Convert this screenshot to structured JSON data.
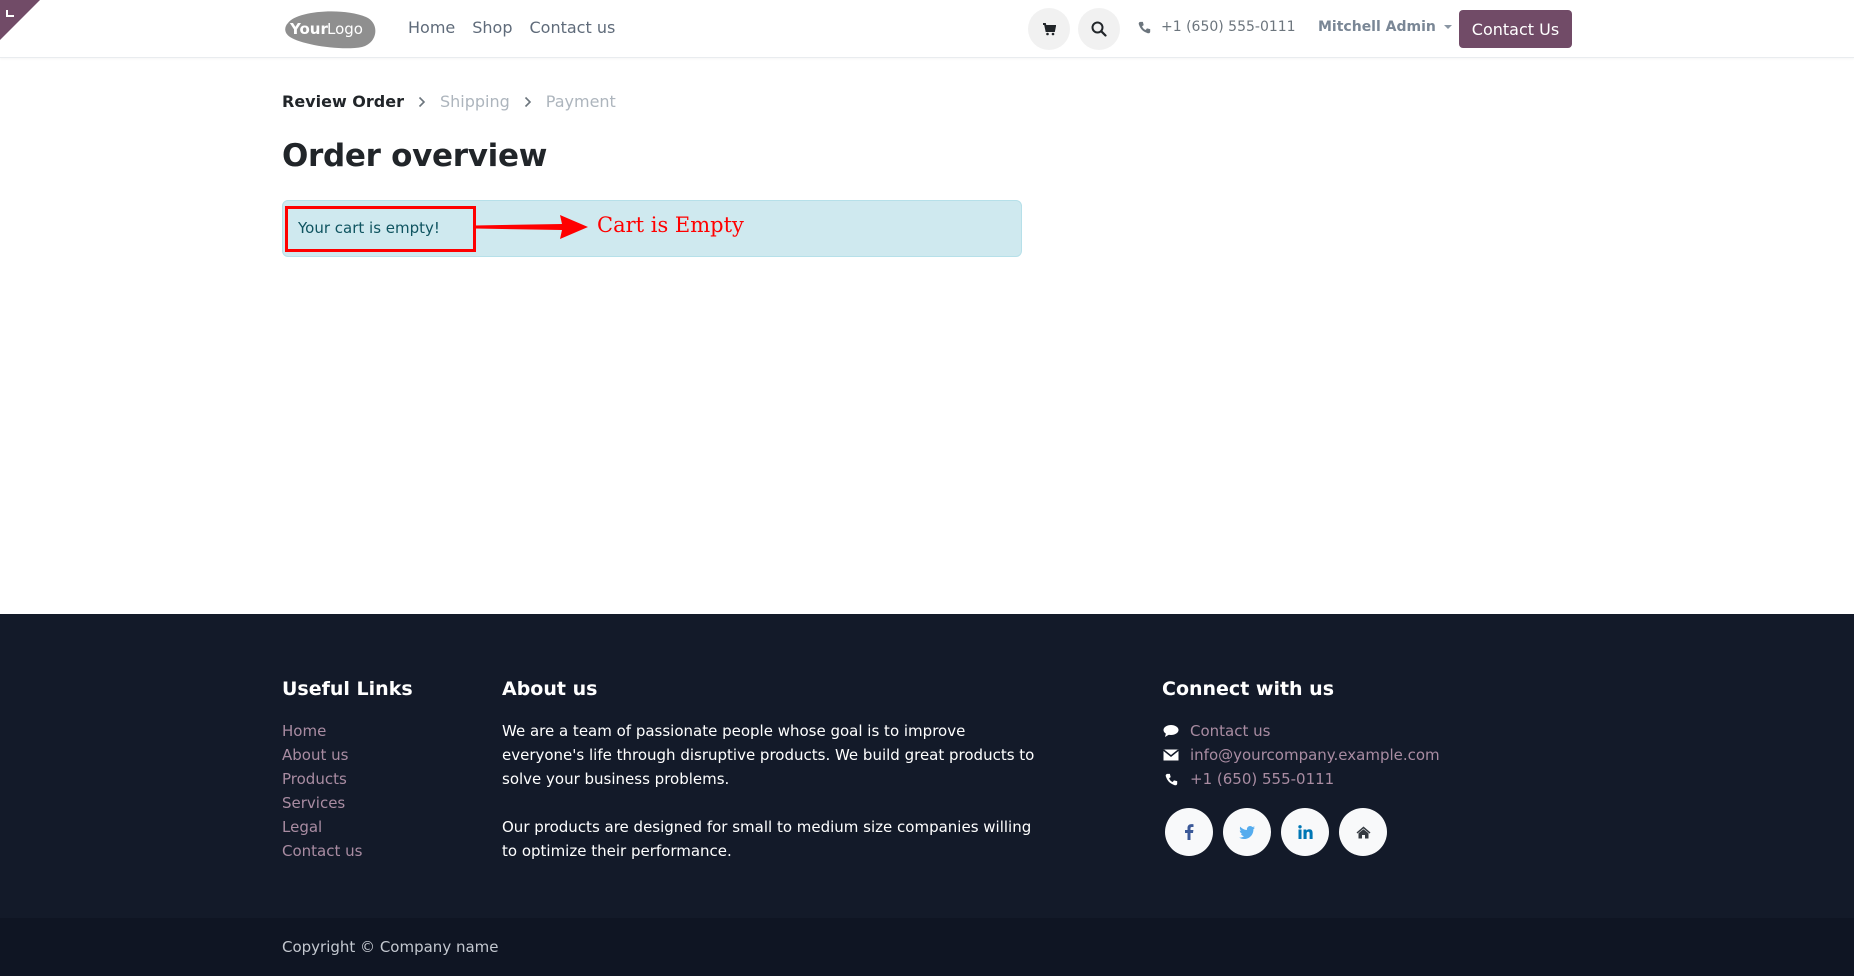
{
  "header": {
    "logo_text_bold": "Your",
    "logo_text_light": "Logo",
    "nav": [
      {
        "label": "Home"
      },
      {
        "label": "Shop"
      },
      {
        "label": "Contact us"
      }
    ],
    "phone": "+1 (650) 555-0111",
    "user_name": "Mitchell Admin",
    "contact_button": "Contact Us",
    "brand_color": "#714b67"
  },
  "checkout": {
    "steps": [
      {
        "label": "Review Order",
        "state": "active"
      },
      {
        "label": "Shipping",
        "state": "inactive"
      },
      {
        "label": "Payment",
        "state": "inactive"
      }
    ],
    "title": "Order overview",
    "alert_message": "Your cart is empty!",
    "annotation_label": "Cart is Empty"
  },
  "footer": {
    "useful_links": {
      "heading": "Useful Links",
      "items": [
        "Home",
        "About us",
        "Products",
        "Services",
        "Legal",
        "Contact us"
      ]
    },
    "about": {
      "heading": "About us",
      "paragraphs": [
        "We are a team of passionate people whose goal is to improve everyone's life through disruptive products. We build great products to solve your business problems.",
        "Our products are designed for small to medium size companies willing to optimize their performance."
      ]
    },
    "connect": {
      "heading": "Connect with us",
      "contact_label": "Contact us",
      "email": "info@yourcompany.example.com",
      "phone": "+1 (650) 555-0111",
      "socials": [
        "facebook",
        "twitter",
        "linkedin",
        "home"
      ]
    },
    "copyright": "Copyright © Company name"
  }
}
